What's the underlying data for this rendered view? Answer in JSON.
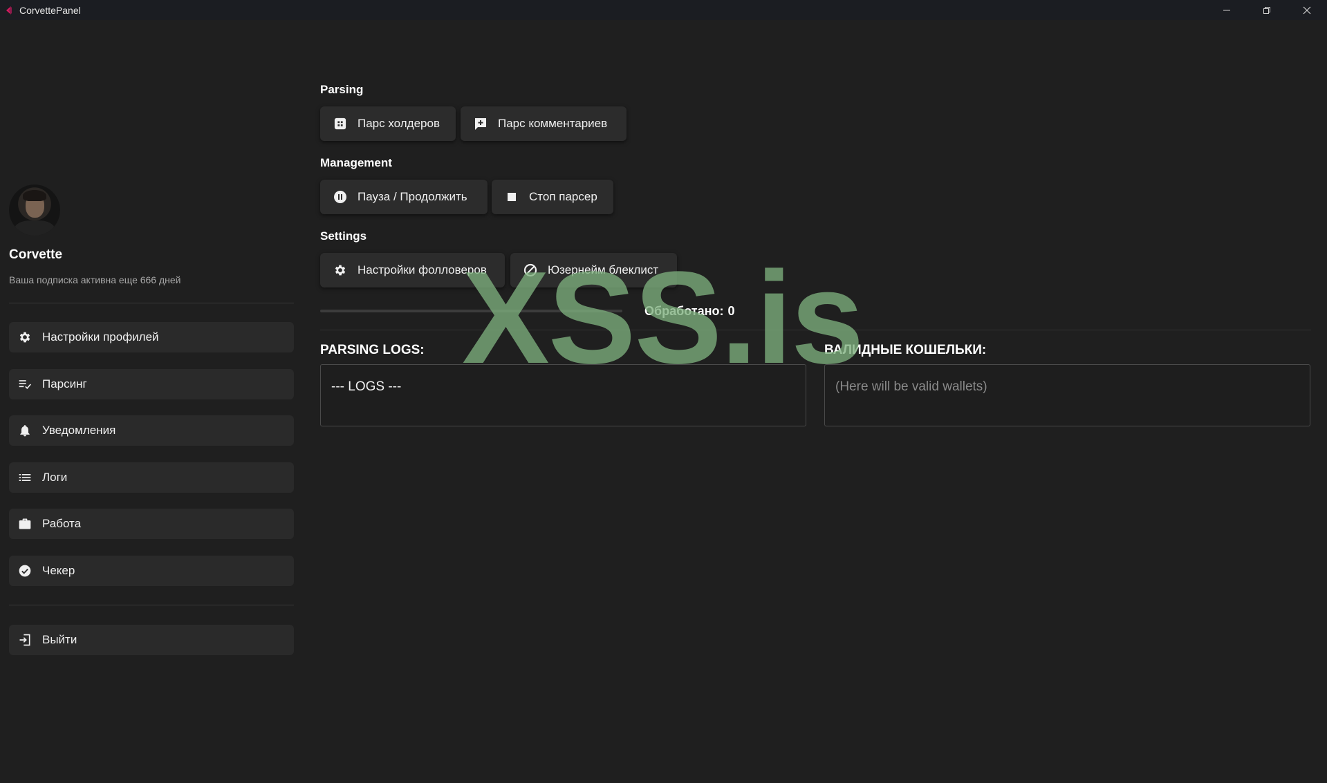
{
  "window": {
    "title": "CorvettePanel",
    "controls": [
      "minimize-icon",
      "restore-icon",
      "close-icon"
    ]
  },
  "sidebar": {
    "user_name": "Corvette",
    "subscription": "Ваша подписка активна еще 666 дней",
    "items": [
      {
        "label": "Настройки профилей",
        "icon": "gear-icon"
      },
      {
        "label": "Парсинг",
        "icon": "list-check-icon"
      },
      {
        "label": "Уведомления",
        "icon": "bell-icon"
      },
      {
        "label": "Логи",
        "icon": "list-icon"
      },
      {
        "label": "Работа",
        "icon": "briefcase-icon"
      },
      {
        "label": "Чекер",
        "icon": "check-circle-icon"
      }
    ],
    "logout": {
      "label": "Выйти",
      "icon": "logout-icon"
    }
  },
  "main": {
    "sections": {
      "parsing": {
        "title": "Parsing",
        "buttons": [
          {
            "label": "Парс холдеров",
            "icon": "grid-icon"
          },
          {
            "label": "Парс комментариев",
            "icon": "add-comment-icon"
          }
        ]
      },
      "management": {
        "title": "Management",
        "buttons": [
          {
            "label": "Пауза / Продолжить",
            "icon": "pause-icon"
          },
          {
            "label": "Стоп парсер",
            "icon": "stop-icon"
          }
        ]
      },
      "settings": {
        "title": "Settings",
        "buttons": [
          {
            "label": "Настройки фолловеров",
            "icon": "gear-icon"
          },
          {
            "label": "Юзернейм блеклист",
            "icon": "block-icon"
          }
        ]
      }
    },
    "progress": {
      "fraction": 0.0
    },
    "processed": {
      "label": "Обработано:",
      "value": "0"
    },
    "logs": {
      "title": "PARSING LOGS:",
      "content": "--- LOGS ---"
    },
    "wallets": {
      "title": "ВАЛИДНЫЕ КОШЕЛЬКИ:",
      "placeholder": "(Here will be valid wallets)"
    }
  },
  "watermark": "XSS.is",
  "colors": {
    "background": "#1f1f1f",
    "button": "#2c2c2c",
    "nav_item": "#2a2a2a",
    "watermark": "#7eb07e",
    "accent": "#c2185b"
  }
}
